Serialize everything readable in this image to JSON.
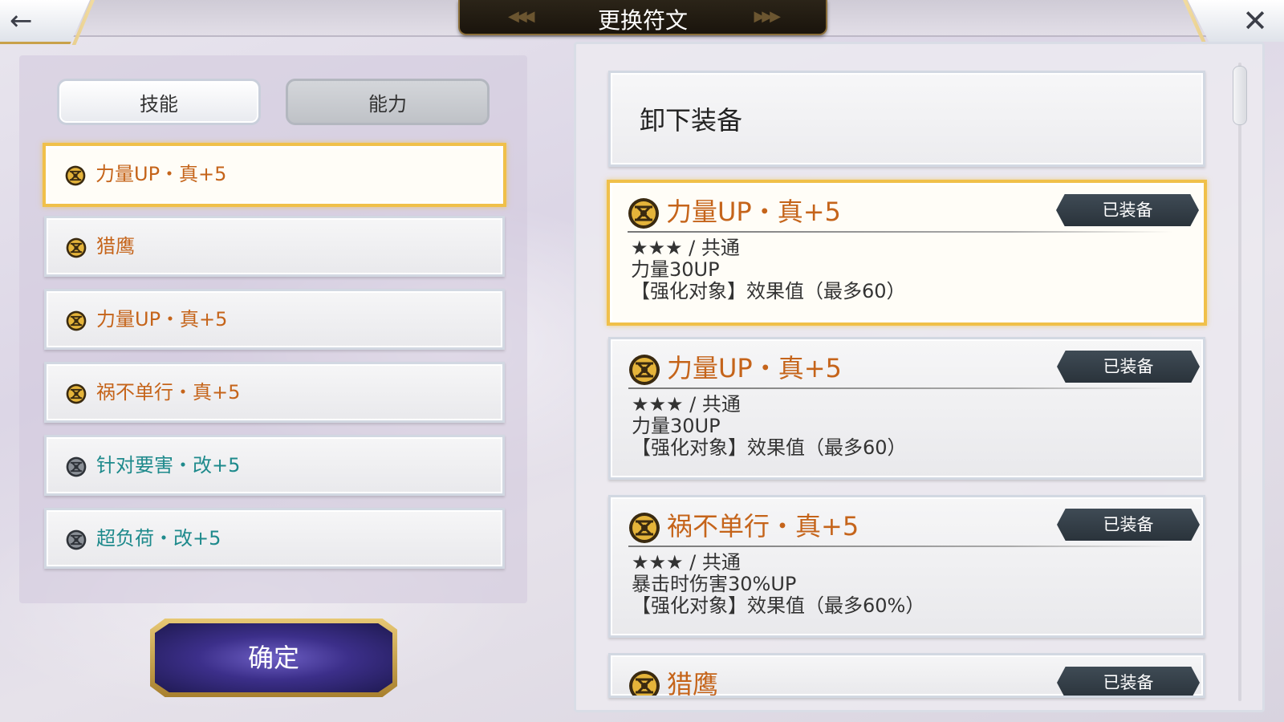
{
  "header": {
    "title": "更换符文",
    "back_icon": "←",
    "close_icon": "✕"
  },
  "tabs": [
    {
      "label": "技能",
      "active": true
    },
    {
      "label": "能力",
      "active": false
    }
  ],
  "rune_list": [
    {
      "label": "力量UP・真+5",
      "color": "#c5641a",
      "icon": "gold-rune-icon",
      "selected": true
    },
    {
      "label": "猎鹰",
      "color": "#c5641a",
      "icon": "gold-rune-icon",
      "selected": false
    },
    {
      "label": "力量UP・真+5",
      "color": "#c5641a",
      "icon": "gold-rune-icon",
      "selected": false
    },
    {
      "label": "祸不单行・真+5",
      "color": "#c5641a",
      "icon": "gold-rune-icon",
      "selected": false
    },
    {
      "label": "针对要害・改+5",
      "color": "#1e8a8c",
      "icon": "dark-rune-icon",
      "selected": false
    },
    {
      "label": "超负荷・改+5",
      "color": "#1e8a8c",
      "icon": "dark-rune-icon",
      "selected": false
    }
  ],
  "confirm_label": "确定",
  "unequip_label": "卸下装备",
  "rune_cards": [
    {
      "name": "力量UP・真+5",
      "badge": "已装备",
      "rarity": "★★★ / 共通",
      "effect": "力量30UP",
      "note": "【强化对象】效果值（最多60）",
      "selected": true
    },
    {
      "name": "力量UP・真+5",
      "badge": "已装备",
      "rarity": "★★★ / 共通",
      "effect": "力量30UP",
      "note": "【强化对象】效果值（最多60）",
      "selected": false
    },
    {
      "name": "祸不单行・真+5",
      "badge": "已装备",
      "rarity": "★★★ / 共通",
      "effect": "暴击时伤害30%UP",
      "note": "【强化对象】效果值（最多60%）",
      "selected": false
    },
    {
      "name": "猎鹰",
      "badge": "已装备",
      "rarity": "",
      "effect": "",
      "note": "",
      "selected": false
    }
  ],
  "colors": {
    "accent_gold": "#f0c04a",
    "rune_orange": "#c5641a",
    "rune_teal": "#1e8a8c",
    "badge_dark": "#2a333b",
    "confirm_purple": "#3c2f8a"
  }
}
